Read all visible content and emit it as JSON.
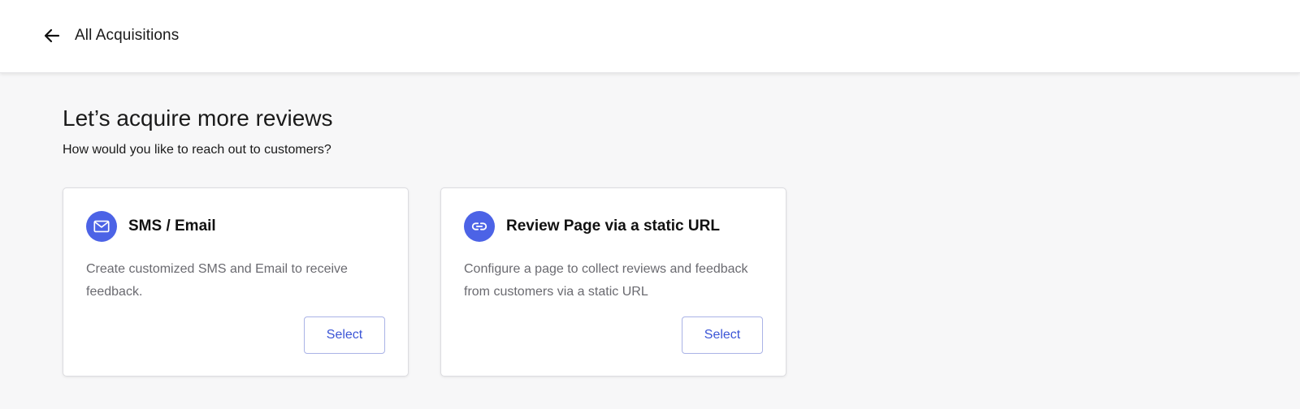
{
  "header": {
    "back_icon": "arrow-left-icon",
    "back_label": "All Acquisitions"
  },
  "main": {
    "heading": "Let’s acquire more reviews",
    "subheading": "How would you like to reach out to customers?"
  },
  "cards": [
    {
      "icon": "mail-icon",
      "title": "SMS / Email",
      "description": "Create customized SMS and Email to receive feedback.",
      "button_label": "Select"
    },
    {
      "icon": "link-icon",
      "title": "Review Page via a static URL",
      "description": "Configure a page to collect reviews and feedback from customers via a static URL",
      "button_label": "Select"
    }
  ],
  "colors": {
    "accent": "#4c63e6",
    "button_text": "#3b55d6",
    "background": "#f7f7f8"
  }
}
